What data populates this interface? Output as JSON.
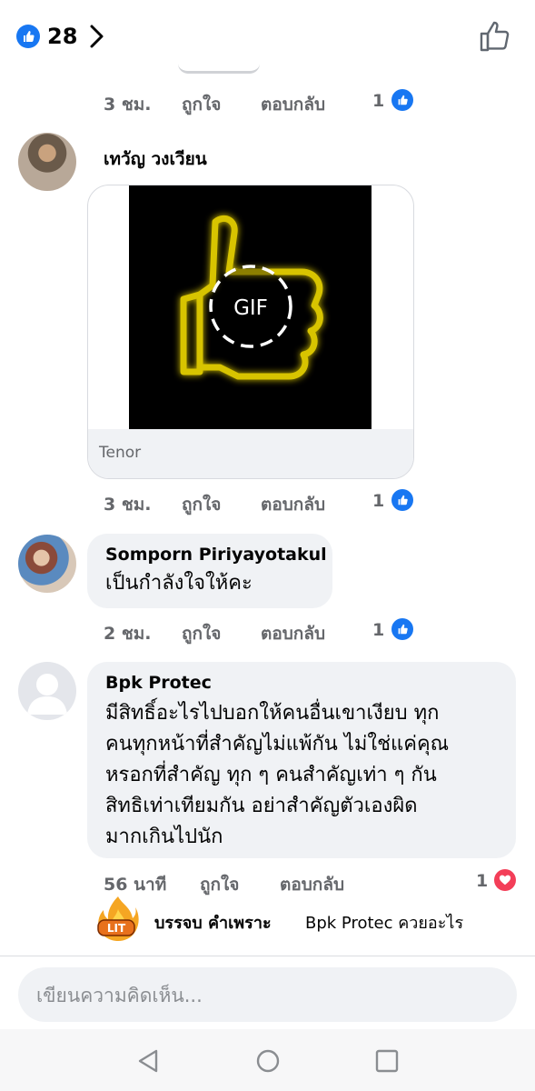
{
  "header": {
    "like_count": "28",
    "like_icon": "like-icon",
    "chevron_icon": "chevron-right-icon",
    "thumb_icon": "thumbs-up-outline-icon"
  },
  "comments": [
    {
      "time": "3 ชม.",
      "like_label": "ถูกใจ",
      "reply_label": "ตอบกลับ",
      "reaction_count": "1",
      "reaction": "like"
    },
    {
      "name": "เทวัญ วงเวียน",
      "gif_label": "GIF",
      "gif_source": "Tenor",
      "time": "3 ชม.",
      "like_label": "ถูกใจ",
      "reply_label": "ตอบกลับ",
      "reaction_count": "1",
      "reaction": "like"
    },
    {
      "name": "Somporn Piriyayotakul",
      "text_lines": [
        "เป็นกำลังใจให้คะ"
      ],
      "time": "2 ชม.",
      "like_label": "ถูกใจ",
      "reply_label": "ตอบกลับ",
      "reaction_count": "1",
      "reaction": "like"
    },
    {
      "name": "Bpk Protec",
      "text_lines": [
        "มีสิทธิ์อะไรไปบอกให้คนอื่นเขาเงียบ ทุก",
        "คนทุกหน้าที่สำคัญไม่แพ้กัน ไม่ใช่แค่คุณ",
        "หรอกที่สำคัญ ทุก ๆ คนสำคัญเท่า ๆ กัน",
        "สิทธิเท่าเทียมกัน อย่าสำคัญตัวเองผิด",
        "มากเกินไปนัก"
      ],
      "time": "56 นาที",
      "like_label": "ถูกใจ",
      "reply_label": "ตอบกลับ",
      "reaction_count": "1",
      "reaction": "love"
    }
  ],
  "reply": {
    "badge_text": "LIT",
    "name": "บรรจบ คำเพราะ",
    "text": "Bpk Protec ควยอะไร"
  },
  "composer": {
    "placeholder": "เขียนความคิดเห็น..."
  },
  "nav": {
    "back_icon": "back-icon",
    "home_icon": "home-icon",
    "recents_icon": "recents-icon"
  },
  "colors": {
    "like_blue": "#1877f2",
    "love_red": "#f33e58",
    "bubble_gray": "#f0f2f5",
    "meta_gray": "#65676b"
  }
}
